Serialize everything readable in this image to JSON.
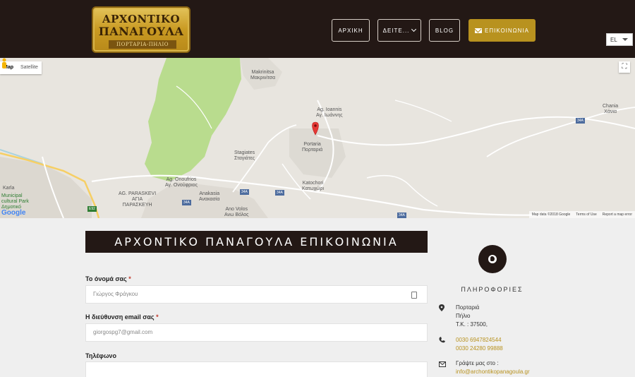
{
  "header": {
    "logo": {
      "line1": "ΑΡΧΟΝΤΙΚΟ",
      "line2": "ΠΑΝΑΓΟΥΛΑ",
      "sub": "ΠΟΡΤΑΡΙΑ-ΠΗΛΙΟ"
    },
    "nav": {
      "home": "ΑΡΧΙΚΗ",
      "see": "ΔΕΙΤΕ...",
      "blog": "BLOG",
      "contact": "ΕΠΙΚΟΙΝΩΝΙΑ"
    },
    "lang": "EL"
  },
  "map": {
    "type_map": "Map",
    "type_satellite": "Satellite",
    "labels": {
      "makrinitsa": "Makrinitsa\nΜακρινίτσα",
      "agioannis": "Ag. Ioannis\nΑγ. Ιωάννης",
      "portaria": "Portaria\nΠορταριά",
      "stagiates": "Stagiates\nΣταγιάτες",
      "onoufrios": "Ag. Onoufrios\nΑγ. Ονούφριος",
      "paraskevi": "AG. PARASKEVI\nΑΓΙΑ\nΠΑΡΑΣΚΕΥΗ",
      "katochori": "Katochori\nΚατωχώρι",
      "anakasia": "Anakasia\nΑνακασία",
      "anovolos": "Ano Volos\nΑνω Βόλος",
      "chania": "Chania\nΧάνια",
      "karla": "Karla",
      "park": "Municipal\ncultural Park\nΔημοτικό"
    },
    "road_badges": {
      "a34": "34A",
      "e92": "E92"
    },
    "zoom_in": "+",
    "zoom_out": "−",
    "footer": {
      "data": "Map data ©2018 Google",
      "terms": "Terms of Use",
      "report": "Report a map error"
    },
    "google": "Google"
  },
  "form": {
    "title": "ΑΡΧΟΝΤΙΚΟ ΠΑΝΑΓΟΥΛΑ ΕΠΙΚΟΙΝΩΝΙΑ",
    "name_label": "Το όνομά σας",
    "name_value": "Γιώργος Φράγκου",
    "email_label": "Η διεύθυνση email σας",
    "email_value": "giorgospg7@gmail.com",
    "phone_label": "Τηλέφωνο",
    "required_mark": "*"
  },
  "info": {
    "title": "ΠΛΗΡΟΦΟΡΙΕΣ",
    "address": [
      "Πορταριά",
      "Πήλιο",
      "Τ.Κ. : 37500,"
    ],
    "phones": [
      "0030 6947824544",
      "0030 24280 99888"
    ],
    "write_label": "Γράψτε μας στο :",
    "email": "info@archontikopanagoula.gr"
  },
  "colors": {
    "dark": "#231815",
    "gold": "#b8921f",
    "map_green": "#b9dc8e"
  }
}
